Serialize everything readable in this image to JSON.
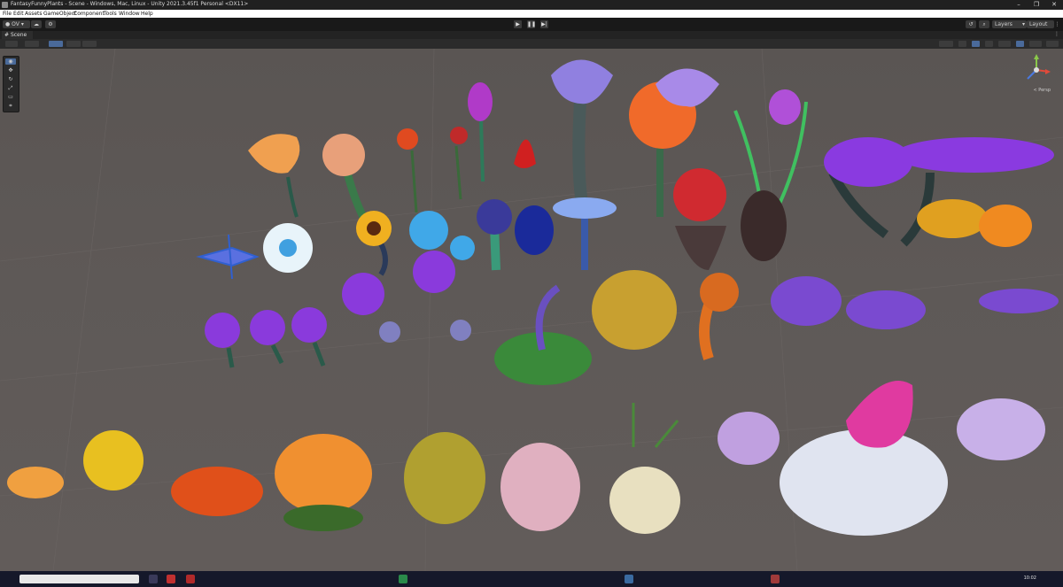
{
  "window": {
    "title": "FantasyFunnyPlants - Scene - Windows, Mac, Linux - Unity 2021.3.45f1 Personal <DX11>",
    "min_icon": "minimize-icon",
    "max_icon": "restore-icon",
    "close_icon": "close-icon"
  },
  "menu": [
    "File",
    "Edit",
    "Assets",
    "GameObject",
    "Component",
    "Tools",
    "Window",
    "Help"
  ],
  "toolbar": {
    "account_label": "OV",
    "layers_label": "Layers",
    "layout_label": "Layout"
  },
  "scene_tab": {
    "label": "Scene"
  },
  "gizmo": {
    "projection_label": "< Persp"
  },
  "taskbar": {
    "time": "10:02"
  },
  "colors": {
    "viewport_bg": "#5e5957",
    "editor_dark": "#191919",
    "accent": "#4a6a9a"
  }
}
